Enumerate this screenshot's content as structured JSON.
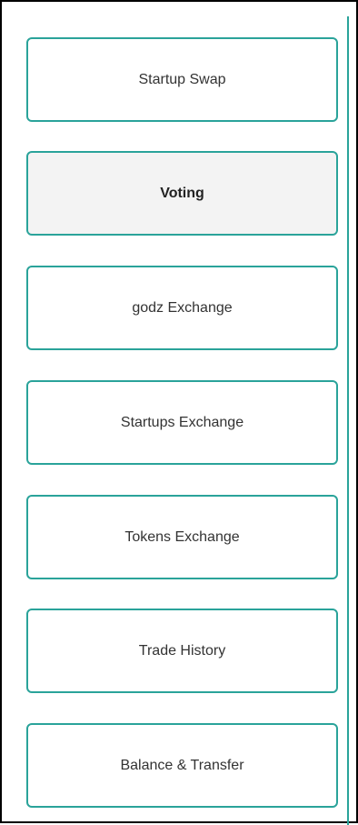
{
  "sidebar": {
    "items": [
      {
        "label": "Startup Swap",
        "active": false
      },
      {
        "label": "Voting",
        "active": true
      },
      {
        "label": "godz Exchange",
        "active": false
      },
      {
        "label": "Startups Exchange",
        "active": false
      },
      {
        "label": "Tokens Exchange",
        "active": false
      },
      {
        "label": "Trade History",
        "active": false
      },
      {
        "label": "Balance & Transfer",
        "active": false
      }
    ]
  },
  "colors": {
    "accent": "#2aa39a",
    "active_background": "#f3f3f3",
    "frame_border": "#000000"
  }
}
